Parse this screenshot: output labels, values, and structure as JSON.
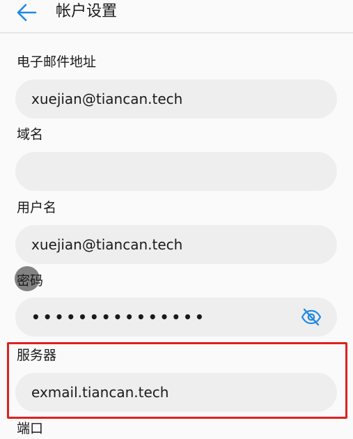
{
  "header": {
    "title": "帐户设置",
    "back_icon": "arrow-left-icon"
  },
  "form": {
    "email": {
      "label": "电子邮件地址",
      "value": "xuejian@tiancan.tech"
    },
    "domain": {
      "label": "域名",
      "value": ""
    },
    "username": {
      "label": "用户名",
      "value": "xuejian@tiancan.tech"
    },
    "password": {
      "label": "密码",
      "masked_value": "•••••••••••••••",
      "toggle_icon": "eye-slash-icon"
    },
    "server": {
      "label": "服务器",
      "value": "exmail.tiancan.tech"
    },
    "port": {
      "label": "端口"
    }
  },
  "colors": {
    "accent": "#1e88e5",
    "field_background": "#eeeeee",
    "highlight": "#e02020",
    "page_background": "#fafafa"
  }
}
